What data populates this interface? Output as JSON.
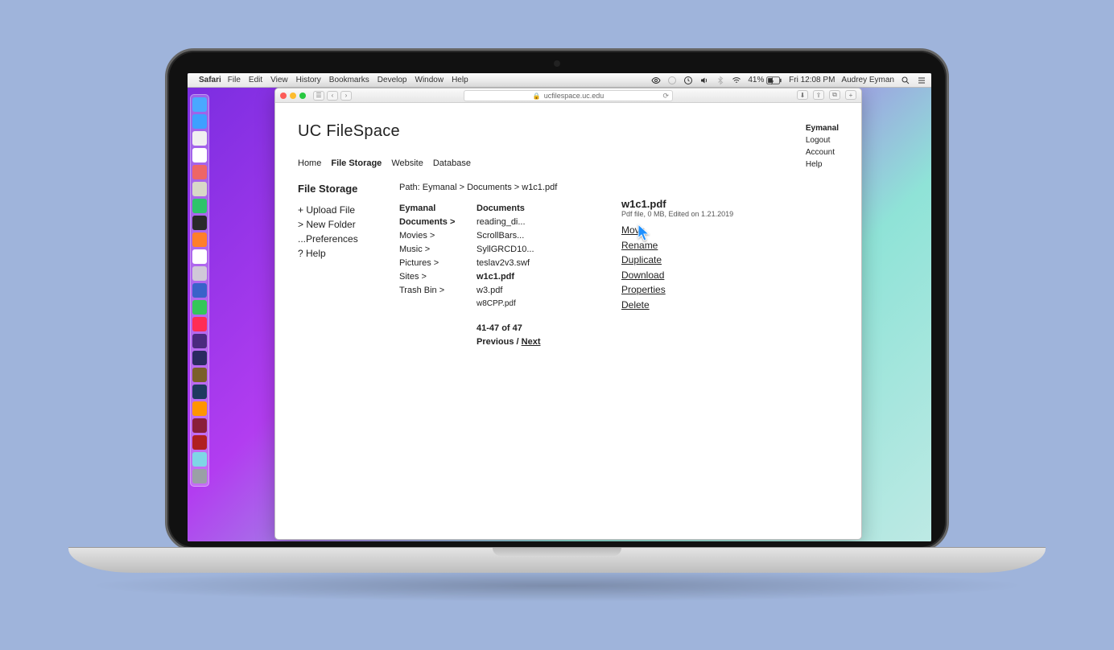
{
  "menubar": {
    "app": "Safari",
    "items": [
      "File",
      "Edit",
      "View",
      "History",
      "Bookmarks",
      "Develop",
      "Window",
      "Help"
    ],
    "battery": "41%",
    "clock": "Fri 12:08 PM",
    "user": "Audrey Eyman"
  },
  "browser": {
    "url": "ucfilespace.uc.edu"
  },
  "site": {
    "name": "UC FileSpace",
    "usernav": {
      "user": "Eymanal",
      "logout": "Logout",
      "account": "Account",
      "help": "Help"
    },
    "mainnav": [
      "Home",
      "File Storage",
      "Website",
      "Database"
    ],
    "mainnav_active": 1
  },
  "left": {
    "title": "File Storage",
    "actions": [
      "+ Upload File",
      "> New Folder",
      "...Preferences",
      "? Help"
    ]
  },
  "path": "Path: Eymanal > Documents > w1c1.pdf",
  "folders": {
    "title": "Eymanal",
    "items": [
      "Documents >",
      "Movies >",
      "Music >",
      "Pictures >",
      "Sites >",
      "Trash Bin >"
    ],
    "selected": 0
  },
  "files": {
    "title": "Documents",
    "items": [
      "reading_di...",
      "ScrollBars...",
      "SyllGRCD10...",
      "teslav2v3.swf",
      "w1c1.pdf",
      "w3.pdf",
      "w8CPP.pdf"
    ],
    "selected": 4
  },
  "pager": {
    "range": "41-47 of 47",
    "prev": "Previous",
    "sep": " / ",
    "next": "Next"
  },
  "details": {
    "filename": "w1c1.pdf",
    "meta": "Pdf file, 0 MB, Edited on 1.21.2019",
    "actions": [
      "Move",
      "Rename",
      "Duplicate",
      "Download",
      "Properties",
      "Delete"
    ]
  },
  "dock_colors": [
    "#4aa8ff",
    "#3ea0ff",
    "#f0f0f0",
    "#ffffff",
    "#e66",
    "#d8d8c8",
    "#2ec46a",
    "#2a2a2a",
    "#ff7f2a",
    "#ffffff",
    "#d0c8d8",
    "#3a62c9",
    "#34c759",
    "#ff2d55",
    "#4b2a7f",
    "#2a2a60",
    "#7a5f2a",
    "#1f3a5f",
    "#ff9500",
    "#8a1f3a",
    "#b02020",
    "#7fd6e6",
    "#9aa0a6"
  ]
}
